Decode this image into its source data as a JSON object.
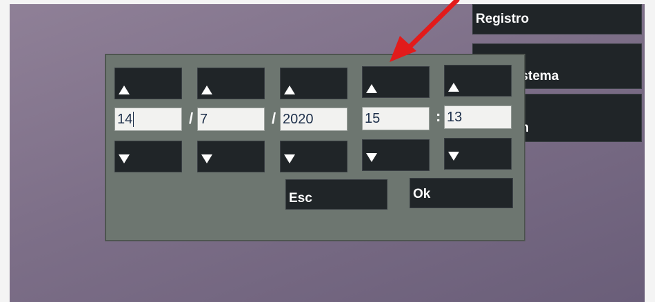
{
  "menu": {
    "registro": "Registro",
    "sistema": "o del sistema",
    "programacion": "amacion"
  },
  "datetime": {
    "day": "14",
    "month": "7",
    "year": "2020",
    "hour": "15",
    "minute": "13",
    "date_sep": "/",
    "time_sep": ":"
  },
  "buttons": {
    "esc": "Esc",
    "ok": "Ok"
  },
  "icons": {
    "increment": "triangle-up",
    "decrement": "triangle-down",
    "annotation": "red-arrow"
  },
  "colors": {
    "background": "#7d6f88",
    "dialog": "#6d7670",
    "button": "#202528",
    "annotation": "#e21b1b"
  }
}
